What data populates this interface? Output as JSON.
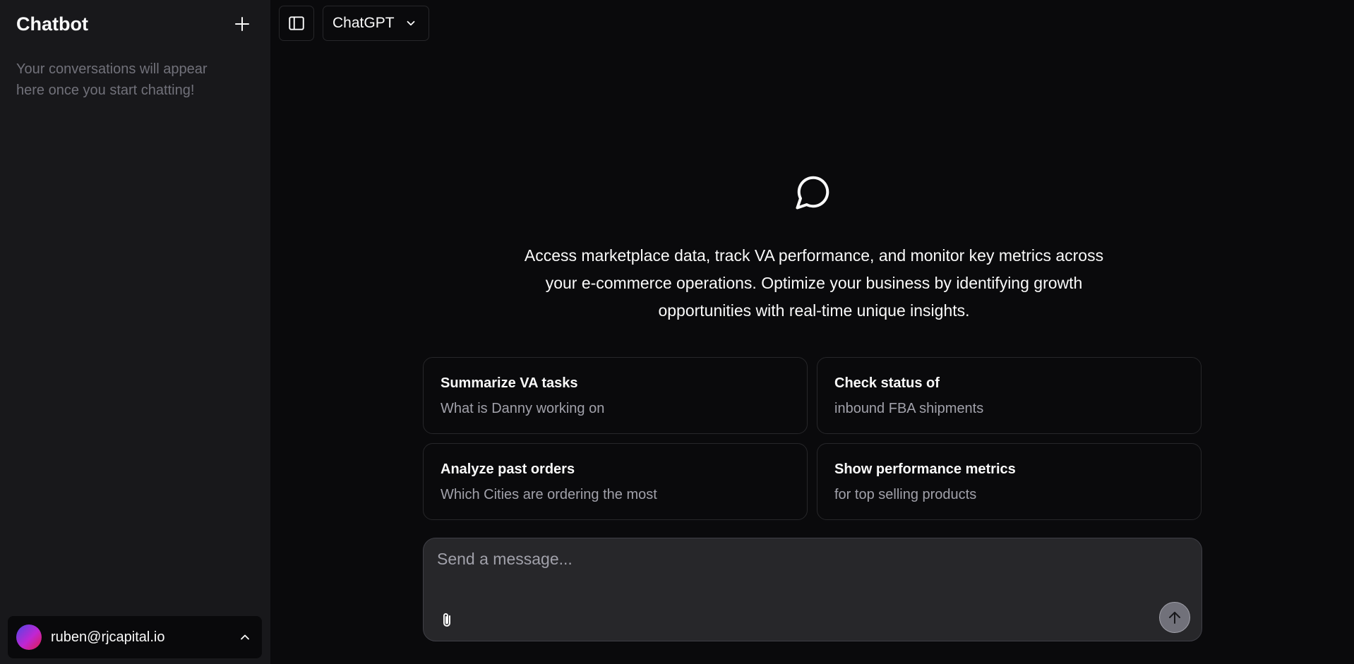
{
  "sidebar": {
    "title": "Chatbot",
    "new_chat_icon": "plus-icon",
    "empty_message": "Your conversations will appear here once you start chatting!",
    "user": {
      "email": "ruben@rjcapital.io",
      "menu_icon": "chevron-up-icon"
    }
  },
  "header": {
    "toggle_icon": "sidebar-toggle-icon",
    "model_label": "ChatGPT",
    "model_icon": "chevron-down-icon"
  },
  "main": {
    "hero_icon": "message-circle-icon",
    "hero_text": "Access marketplace data, track VA performance, and monitor key metrics across your e-commerce operations. Optimize your business by identifying growth opportunities with real-time unique insights.",
    "suggestions": [
      {
        "title": "Summarize VA tasks",
        "subtitle": "What is Danny working on"
      },
      {
        "title": "Check status of",
        "subtitle": "inbound FBA shipments"
      },
      {
        "title": "Analyze past orders",
        "subtitle": "Which Cities are ordering the most"
      },
      {
        "title": "Show performance metrics",
        "subtitle": "for top selling products"
      }
    ]
  },
  "composer": {
    "placeholder": "Send a message...",
    "value": "",
    "attach_icon": "paperclip-icon",
    "send_icon": "arrow-up-icon"
  },
  "colors": {
    "background": "#0a0a0c",
    "sidebar": "#18181b",
    "border": "#27272a",
    "muted_text": "#a1a1aa"
  }
}
